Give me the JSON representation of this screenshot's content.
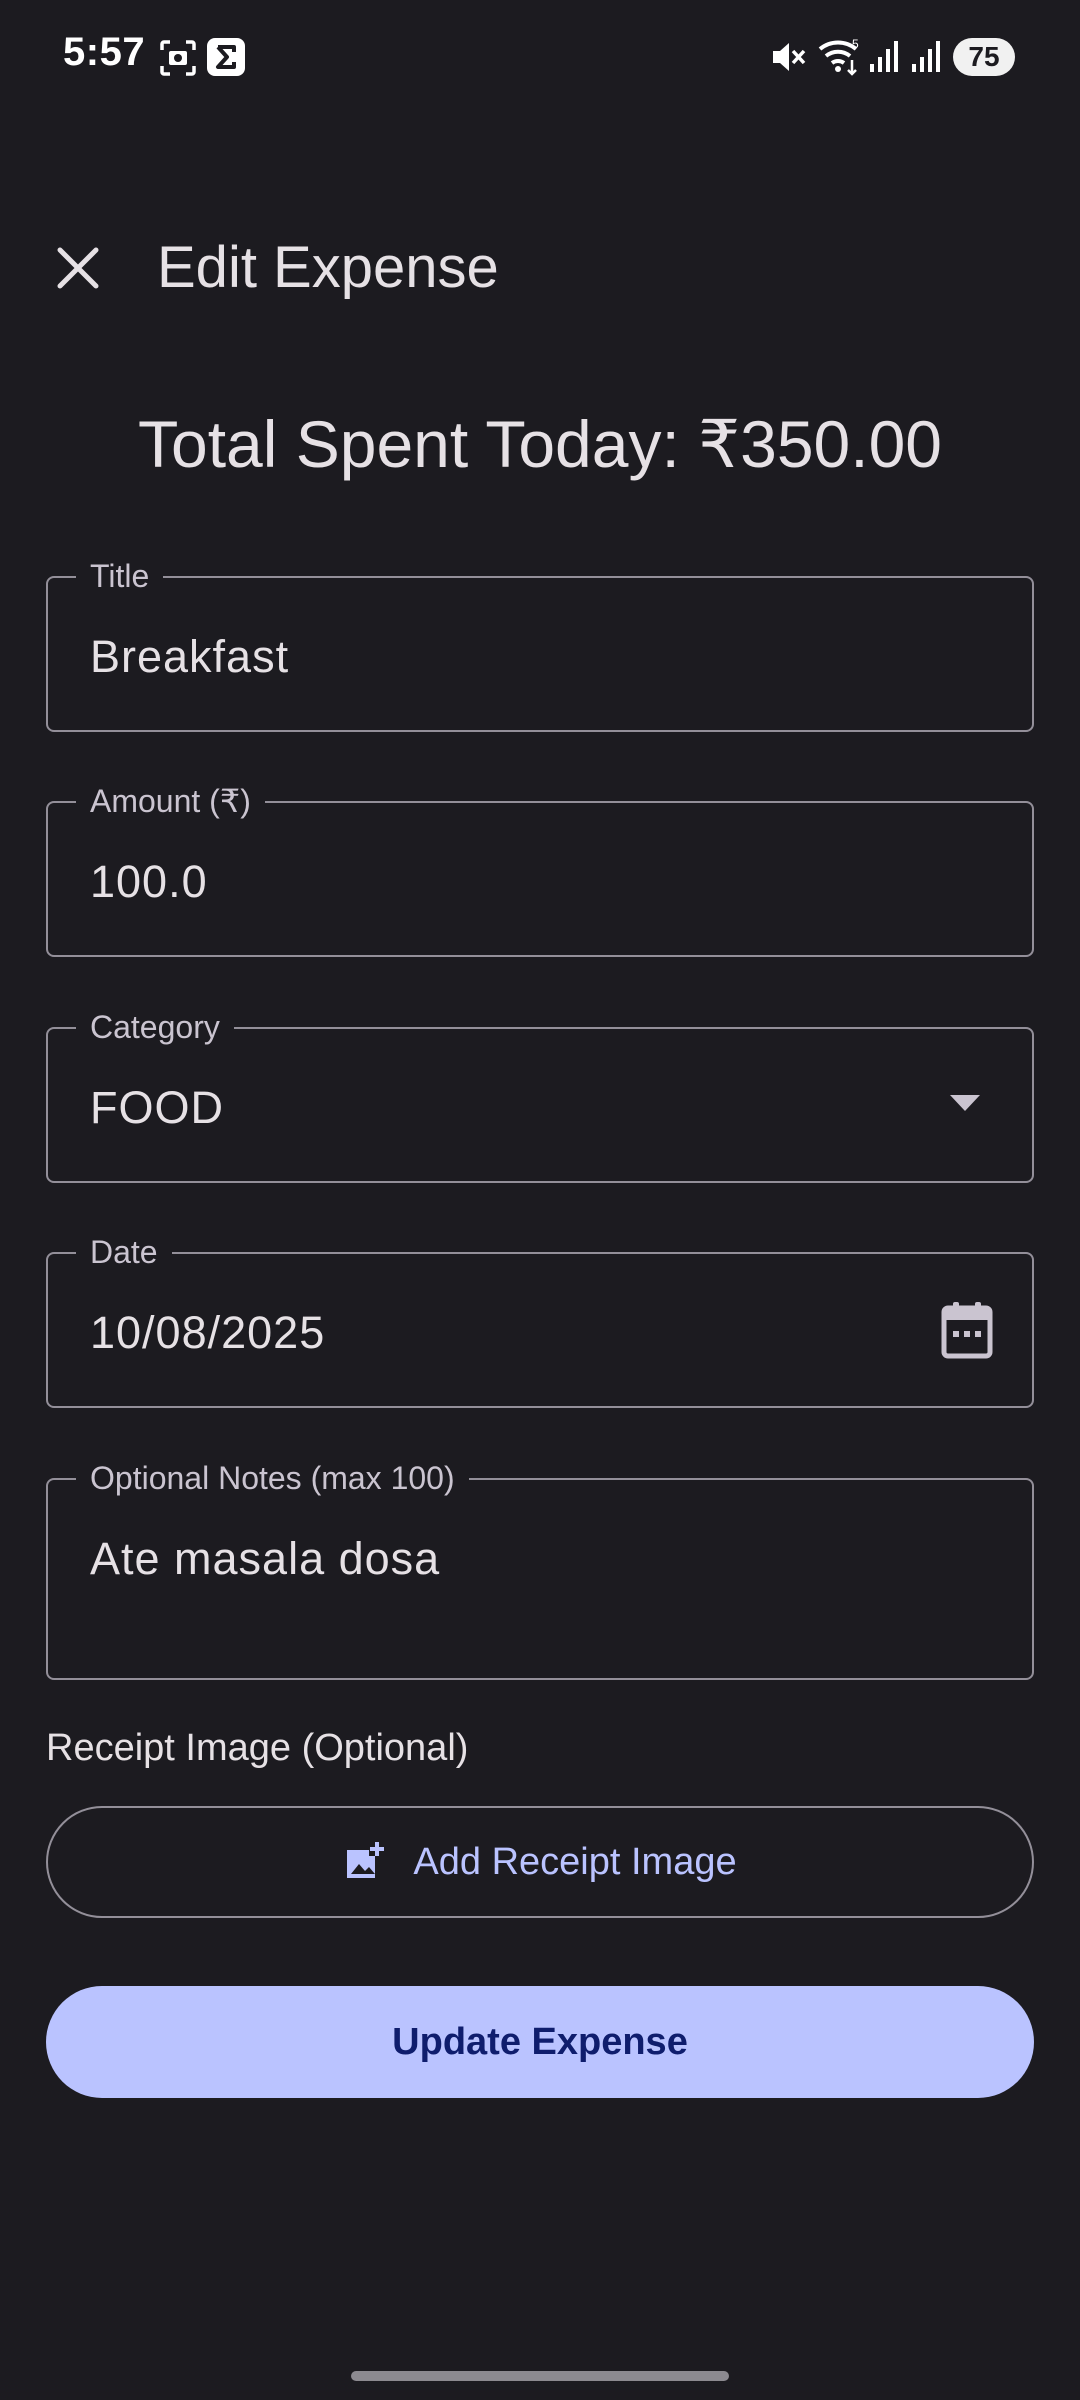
{
  "status_bar": {
    "time": "5:57",
    "battery": "75",
    "icons": [
      "screenshot-icon",
      "sigma-app-icon",
      "mute-icon",
      "wifi-icon",
      "signal-icon",
      "signal-icon"
    ]
  },
  "app_bar": {
    "close_icon": "close-icon",
    "title": "Edit Expense"
  },
  "summary": {
    "total_text": "Total Spent Today: ₹350.00"
  },
  "form": {
    "title": {
      "label": "Title",
      "value": "Breakfast"
    },
    "amount": {
      "label": "Amount (₹)",
      "value": "100.0"
    },
    "category": {
      "label": "Category",
      "value": "FOOD",
      "icon": "dropdown-arrow-icon"
    },
    "date": {
      "label": "Date",
      "value": "10/08/2025",
      "icon": "calendar-icon"
    },
    "notes": {
      "label": "Optional Notes (max 100)",
      "value": "Ate masala dosa"
    }
  },
  "receipt": {
    "label": "Receipt Image (Optional)",
    "add_button": "Add Receipt Image",
    "icon": "add-photo-icon"
  },
  "actions": {
    "update_button": "Update Expense"
  },
  "colors": {
    "background": "#1c1b20",
    "primary": "#bac3ff",
    "on_primary": "#0f1d6d",
    "outline": "#938f99"
  }
}
